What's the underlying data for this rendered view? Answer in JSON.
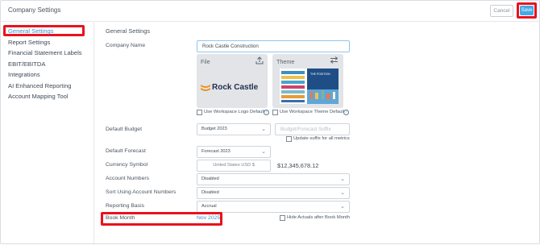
{
  "header": {
    "title": "Company Settings",
    "cancel_label": "Cancel",
    "save_label": "Save"
  },
  "sidebar": {
    "items": [
      {
        "label": "General Settings"
      },
      {
        "label": "Report Settings"
      },
      {
        "label": "Financial Statement Labels"
      },
      {
        "label": "EBIT/EBITDA"
      },
      {
        "label": "Integrations"
      },
      {
        "label": "AI Enhanced Reporting"
      },
      {
        "label": "Account Mapping Tool"
      }
    ]
  },
  "main": {
    "section_title": "General Settings",
    "company_name": {
      "label": "Company Name",
      "value": "Rock Castle Construction"
    },
    "file_card": {
      "title": "File",
      "logo_text": "Rock Castle",
      "upload_icon": "upload-icon"
    },
    "theme_card": {
      "title": "Theme",
      "switch_icon": "swap-arrows-icon",
      "thumbnail_caption": "THE POSITION"
    },
    "use_logo_default": "Use Workspace Logo Default",
    "use_theme_default": "Use Workspace Theme Default",
    "default_budget": {
      "label": "Default Budget",
      "value": "Budget 2023",
      "suffix_placeholder": "Budget/Forecast Suffix"
    },
    "update_suffix_label": "Update suffix for all metrics",
    "default_forecast": {
      "label": "Default Forecast",
      "value": "Forecast 2023"
    },
    "currency": {
      "label": "Currency Symbol",
      "value": "United States USD $",
      "example": "$12,345,678.12"
    },
    "account_numbers": {
      "label": "Account Numbers",
      "value": "Disabled"
    },
    "sort_account_numbers": {
      "label": "Sort Using Account Numbers",
      "value": "Disabled"
    },
    "reporting_basis": {
      "label": "Reporting Basis",
      "value": "Accrual"
    },
    "book_month": {
      "label": "Book Month",
      "value": "Nov 2025",
      "hide_actuals_label": "Hide Actuals after Book Month"
    }
  },
  "colors": {
    "accent": "#45a9e6",
    "highlight": "#e8131e",
    "link": "#3a8fd0",
    "logo_orange": "#f0901e",
    "logo_navy": "#1f2d4d"
  }
}
